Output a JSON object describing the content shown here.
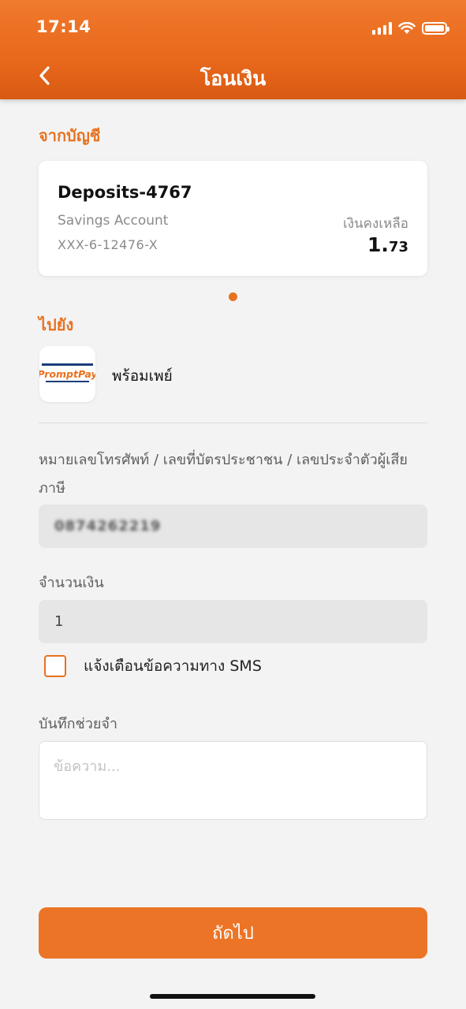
{
  "status_bar": {
    "time": "17:14"
  },
  "header": {
    "title": "โอนเงิน"
  },
  "from_section": {
    "label": "จากบัญชี",
    "account": {
      "name": "Deposits-4767",
      "type": "Savings Account",
      "number": "XXX-6-12476-X",
      "balance_label": "เงินคงเหลือ",
      "balance_int": "1.",
      "balance_dec": "73"
    }
  },
  "to_section": {
    "label": "ไปยัง",
    "logo_text": "PromptPay",
    "service_name": "พร้อมเพย์"
  },
  "form": {
    "phone_label": "หมายเลขโทรศัพท์ / เลขที่บัตรประชาชน / เลขประจำตัวผู้เสียภาษี",
    "phone_value": "0874262219",
    "amount_label": "จำนวนเงิน",
    "amount_value": "1",
    "sms_label": "แจ้งเตือนข้อความทาง SMS",
    "sms_checked": false,
    "memo_label": "บันทึกช่วยจำ",
    "memo_placeholder": "ข้อความ..."
  },
  "next_button": {
    "label": "ถัดไป"
  },
  "colors": {
    "accent": "#e8711f",
    "header_top": "#f07a2c",
    "header_bottom": "#d85a12"
  }
}
